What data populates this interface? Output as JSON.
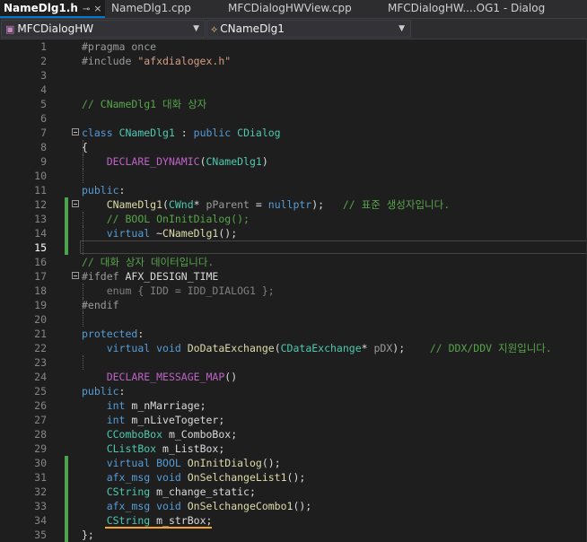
{
  "tabs": [
    {
      "label": "NameDlg1.h",
      "pin": "⊸",
      "close": "×",
      "active": true
    },
    {
      "label": "NameDlg1.cpp",
      "active": false
    },
    {
      "label": "MFCDialogHWView.cpp",
      "active": false
    },
    {
      "label": "MFCDialogHW....OG1 - Dialog",
      "active": false
    }
  ],
  "nav": {
    "project": "MFCDialogHW",
    "scope": "CNameDlg1"
  },
  "current_line": 15,
  "lines": [
    {
      "n": "1",
      "html": "<span class='pp'>#pragma once</span>"
    },
    {
      "n": "2",
      "html": "<span class='pp'>#include </span><span class='st'>\"afxdialogex.h\"</span>"
    },
    {
      "n": "3",
      "html": ""
    },
    {
      "n": "4",
      "html": ""
    },
    {
      "n": "5",
      "html": "<span class='cm'>// CNameDlg1 대화 상자</span>"
    },
    {
      "n": "6",
      "html": ""
    },
    {
      "n": "7",
      "html": "<span class='kw'>class</span> <span class='ty'>CNameDlg1</span> : <span class='kw'>public</span> <span class='ty'>CDialog</span>"
    },
    {
      "n": "8",
      "html": "{"
    },
    {
      "n": "9",
      "html": "    <span class='mc'>DECLARE_DYNAMIC</span>(<span class='ty'>CNameDlg1</span>)"
    },
    {
      "n": "10",
      "html": ""
    },
    {
      "n": "11",
      "html": "<span class='kw'>public</span>:"
    },
    {
      "n": "12",
      "html": "    <span class='fn'>CNameDlg1</span>(<span class='ty'>CWnd</span>* <span class='pa'>pParent</span> = <span class='kw'>nullptr</span>);   <span class='cm'>// 표준 생성자입니다.</span>"
    },
    {
      "n": "13",
      "html": "    <span class='cm'>// BOOL OnInitDialog();</span>"
    },
    {
      "n": "14",
      "html": "    <span class='kw'>virtual</span> ~<span class='fn'>CNameDlg1</span>();"
    },
    {
      "n": "15",
      "html": ""
    },
    {
      "n": "16",
      "html": "<span class='cm'>// 대화 상자 데이터입니다.</span>"
    },
    {
      "n": "17",
      "html": "<span class='pp'>#ifdef</span> <span class='vr'>AFX_DESIGN_TIME</span>"
    },
    {
      "n": "18",
      "html": "    <span class='gr'>enum { IDD = IDD_DIALOG1 };</span>"
    },
    {
      "n": "19",
      "html": "<span class='pp'>#endif</span>"
    },
    {
      "n": "20",
      "html": ""
    },
    {
      "n": "21",
      "html": "<span class='kw'>protected</span>:"
    },
    {
      "n": "22",
      "html": "    <span class='kw'>virtual</span> <span class='kw'>void</span> <span class='fn'>DoDataExchange</span>(<span class='ty'>CDataExchange</span>* <span class='pa'>pDX</span>);    <span class='cm'>// DDX/DDV 지원입니다.</span>"
    },
    {
      "n": "23",
      "html": ""
    },
    {
      "n": "24",
      "html": "    <span class='mc'>DECLARE_MESSAGE_MAP</span>()"
    },
    {
      "n": "25",
      "html": "<span class='kw'>public</span>:"
    },
    {
      "n": "26",
      "html": "    <span class='kw'>int</span> <span class='vr'>m_nMarriage</span>;"
    },
    {
      "n": "27",
      "html": "    <span class='kw'>int</span> <span class='vr'>m_nLiveTogeter</span>;"
    },
    {
      "n": "28",
      "html": "    <span class='ty'>CComboBox</span> <span class='vr'>m_ComboBox</span>;"
    },
    {
      "n": "29",
      "html": "    <span class='ty'>CListBox</span> <span class='vr'>m_ListBox</span>;"
    },
    {
      "n": "30",
      "html": "    <span class='kw'>virtual</span> <span class='kw'>BOOL</span> <span class='fn'>OnInitDialog</span>();"
    },
    {
      "n": "31",
      "html": "    <span class='kw'>afx_msg</span> <span class='kw'>void</span> <span class='fn'>OnSelchangeList1</span>();"
    },
    {
      "n": "32",
      "html": "    <span class='ty'>CString</span> <span class='vr'>m_change_static</span>;"
    },
    {
      "n": "33",
      "html": "    <span class='kw'>afx_msg</span> <span class='kw'>void</span> <span class='fn'>OnSelchangeCombo1</span>();"
    },
    {
      "n": "34",
      "html": "    <span class='ty'>CString</span> <span class='vr'>m_strBox</span>;"
    },
    {
      "n": "35",
      "html": "};"
    }
  ],
  "changed_lines": [
    12,
    13,
    14,
    15,
    30,
    31,
    32,
    33,
    34,
    35
  ],
  "fold_lines": [
    7,
    12,
    17
  ],
  "guide_lines": [
    8,
    9,
    10,
    13,
    14,
    15,
    18,
    19,
    20,
    23
  ]
}
